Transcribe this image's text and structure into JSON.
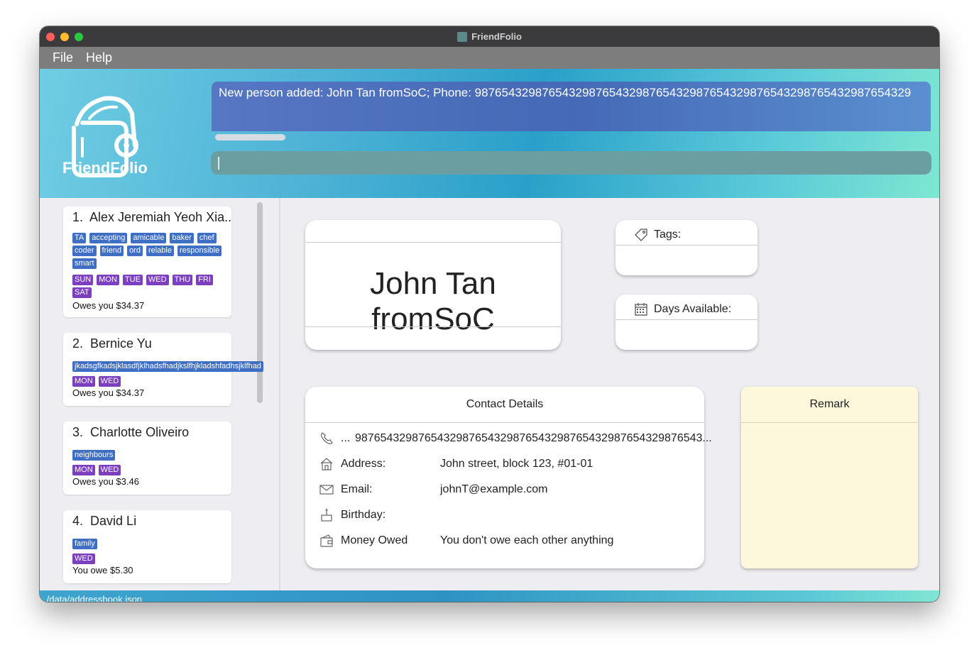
{
  "window": {
    "title": "FriendFolio"
  },
  "menu": {
    "file": "File",
    "help": "Help"
  },
  "header": {
    "logo_text": "FriendFolio",
    "result_message": "New person added: John Tan fromSoC; Phone: 98765432987654329876543298765432987654329876543298765432987654329",
    "command_value": ""
  },
  "persons": [
    {
      "index": "1.",
      "name": "Alex Jeremiah Yeoh Xia...",
      "tags": [
        "TA",
        "accepting",
        "amicable",
        "baker",
        "chef",
        "coder",
        "friend",
        "ord",
        "relable",
        "responsible",
        "smart"
      ],
      "days": [
        "SUN",
        "MON",
        "TUE",
        "WED",
        "THU",
        "FRI",
        "SAT"
      ],
      "owe": "Owes you $34.37"
    },
    {
      "index": "2.",
      "name": "Bernice  Yu",
      "tags": [
        "jkadsgfkadsjklasdfjklhadsfhadjkslfhjkladshfadhsjklfhad"
      ],
      "days": [
        "MON",
        "WED"
      ],
      "owe": "Owes you $34.37"
    },
    {
      "index": "3.",
      "name": "Charlotte Oliveiro",
      "tags": [
        "neighbours"
      ],
      "days": [
        "MON",
        "WED"
      ],
      "owe": "Owes you $3.46"
    },
    {
      "index": "4.",
      "name": "David Li",
      "tags": [
        "family"
      ],
      "days": [
        "WED"
      ],
      "owe": "You owe $5.30"
    }
  ],
  "detail": {
    "name": "John Tan fromSoC",
    "tags_label": "Tags:",
    "days_label": "Days Available:",
    "contact_title": "Contact Details",
    "phone_label": "...",
    "phone_value": "9876543298765432987654329876543298765432987654329876543...",
    "address_label": "Address:",
    "address_value": "John street, block 123, #01-01",
    "email_label": "Email:",
    "email_value": "johnT@example.com",
    "birthday_label": "Birthday:",
    "birthday_value": "",
    "money_label": "Money Owed",
    "money_value": "You don't owe each other anything",
    "remark_title": "Remark",
    "remark_value": ""
  },
  "status": {
    "path": "./data/addressbook.json"
  }
}
